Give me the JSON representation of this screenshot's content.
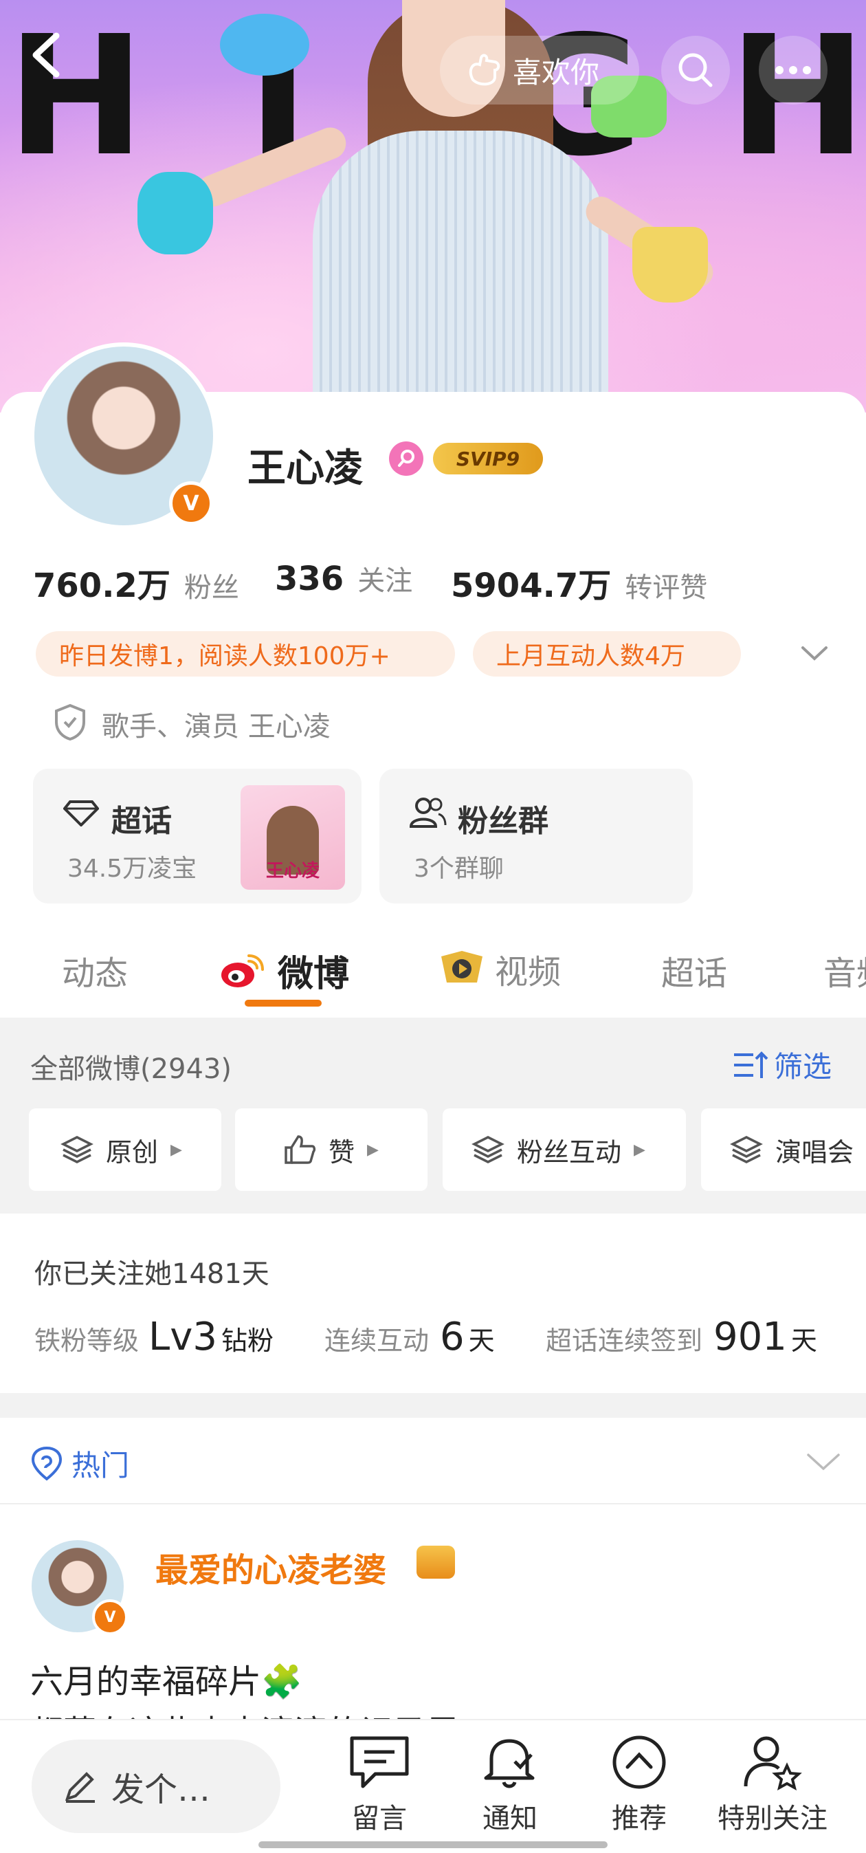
{
  "header": {
    "like_label": "喜欢你",
    "banner_text": [
      "H",
      "I",
      "G",
      "H"
    ]
  },
  "profile": {
    "name": "王心凌",
    "svip_label": "SVIP9",
    "verified_letter": "V",
    "stats": [
      {
        "value": "760.2万",
        "label": "粉丝"
      },
      {
        "value": "336",
        "label": "关注"
      },
      {
        "value": "5904.7万",
        "label": "转评赞"
      }
    ],
    "tags": [
      "昨日发博1，阅读人数100万+",
      "上月互动人数4万"
    ],
    "description": "歌手、演员 王心凌",
    "supertopic": {
      "title": "超话",
      "subtitle": "34.5万凌宝",
      "thumb_text": "王心凌"
    },
    "fangroup": {
      "title": "粉丝群",
      "subtitle": "3个群聊"
    }
  },
  "tabs": [
    "动态",
    "微博",
    "视频",
    "超话",
    "音频"
  ],
  "active_tab_index": 1,
  "feed": {
    "all_label": "全部微博(2943)",
    "filter_label": "筛选",
    "chips": [
      "原创",
      "赞",
      "粉丝互动",
      "演唱会"
    ]
  },
  "fan": {
    "followed_text": "你已关注她1481天",
    "level_label": "铁粉等级",
    "level_value": "Lv3",
    "level_suffix": "钻粉",
    "interact_label": "连续互动",
    "interact_value": "6",
    "interact_unit": "天",
    "checkin_label": "超话连续签到",
    "checkin_value": "901",
    "checkin_unit": "天"
  },
  "hot": {
    "label": "热门"
  },
  "post": {
    "author": "最爱的心凌老婆",
    "line1": "六月的幸福碎片🧩",
    "line2": "都藏在这些点点滴滴的记录里"
  },
  "bottom_bar": {
    "compose_placeholder": "发个…",
    "items": [
      "留言",
      "通知",
      "推荐",
      "特别关注"
    ]
  },
  "colors": {
    "accent": "#f0790f",
    "tag_bg": "#fdeee4",
    "link_blue": "#3b6fd8"
  }
}
